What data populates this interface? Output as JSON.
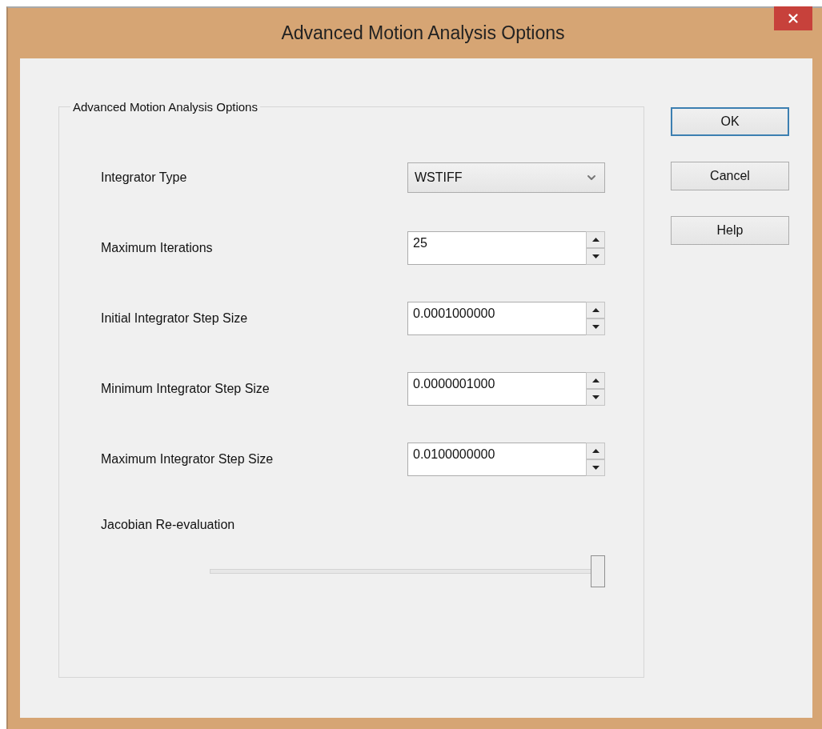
{
  "window": {
    "title": "Advanced Motion Analysis Options"
  },
  "group": {
    "label": "Advanced Motion Analysis Options",
    "rows": [
      {
        "kind": "dropdown",
        "label": "Integrator Type",
        "value": "WSTIFF"
      },
      {
        "kind": "spinner",
        "label": "Maximum Iterations",
        "value": "25"
      },
      {
        "kind": "spinner",
        "label": "Initial Integrator Step Size",
        "value": "0.0001000000"
      },
      {
        "kind": "spinner",
        "label": "Minimum Integrator Step Size",
        "value": "0.0000001000"
      },
      {
        "kind": "spinner",
        "label": "Maximum Integrator Step Size",
        "value": "0.0100000000"
      },
      {
        "kind": "slider",
        "label": "Jacobian Re-evaluation",
        "level": 1
      }
    ]
  },
  "buttons": [
    {
      "label": "OK",
      "default": true
    },
    {
      "label": "Cancel",
      "default": false
    },
    {
      "label": "Help",
      "default": false
    }
  ]
}
